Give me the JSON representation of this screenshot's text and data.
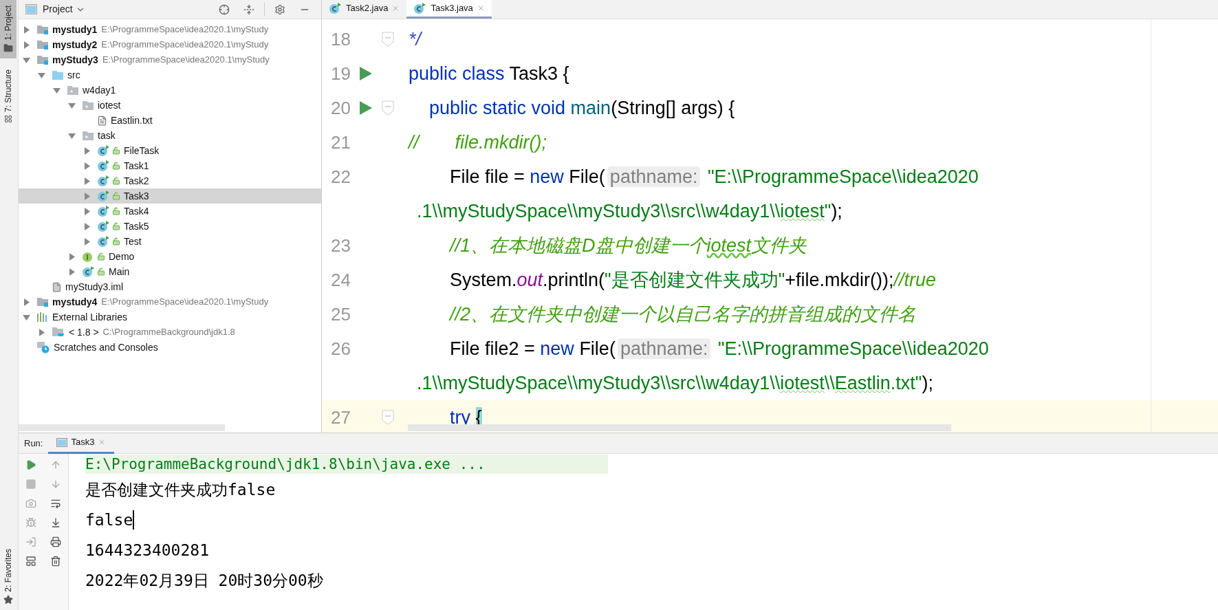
{
  "tool_strip": {
    "top": [
      {
        "label": "1: Project",
        "kind": "folder",
        "selected": true
      },
      {
        "label": "7: Structure",
        "kind": "structure",
        "selected": false
      }
    ],
    "bottom": [
      {
        "label": "2: Favorites",
        "kind": "star",
        "selected": false
      }
    ]
  },
  "project_panel": {
    "title": "Project"
  },
  "tree": [
    {
      "label": "mystudy1",
      "path": "E:\\ProgrammeSpace\\idea2020.1\\myStudy",
      "kind": "module",
      "expanded": false,
      "selected": false
    },
    {
      "label": "mystudy2",
      "path": "E:\\ProgrammeSpace\\idea2020.1\\myStudy",
      "kind": "module",
      "expanded": false,
      "selected": false
    },
    {
      "label": "myStudy3",
      "path": "E:\\ProgrammeSpace\\idea2020.1\\myStudy",
      "kind": "module",
      "expanded": true,
      "selected": false,
      "children": [
        {
          "label": "src",
          "kind": "source",
          "expanded": true,
          "selected": false,
          "children": [
            {
              "label": "w4day1",
              "kind": "package",
              "expanded": true,
              "selected": false,
              "children": [
                {
                  "label": "iotest",
                  "kind": "package",
                  "expanded": true,
                  "selected": false,
                  "children": [
                    {
                      "label": "Eastlin.txt",
                      "kind": "text-file",
                      "selected": false
                    }
                  ]
                },
                {
                  "label": "task",
                  "kind": "package",
                  "expanded": true,
                  "selected": false,
                  "children": [
                    {
                      "label": "FileTask",
                      "kind": "class",
                      "expanded": false,
                      "selected": false
                    },
                    {
                      "label": "Task1",
                      "kind": "class",
                      "expanded": false,
                      "selected": false
                    },
                    {
                      "label": "Task2",
                      "kind": "class",
                      "expanded": false,
                      "selected": false
                    },
                    {
                      "label": "Task3",
                      "kind": "class",
                      "expanded": false,
                      "selected": true
                    },
                    {
                      "label": "Task4",
                      "kind": "class",
                      "expanded": false,
                      "selected": false
                    },
                    {
                      "label": "Task5",
                      "kind": "class",
                      "expanded": false,
                      "selected": false
                    },
                    {
                      "label": "Test",
                      "kind": "class",
                      "expanded": false,
                      "selected": false
                    }
                  ]
                },
                {
                  "label": "Demo",
                  "kind": "interface",
                  "expanded": false,
                  "selected": false
                },
                {
                  "label": "Main",
                  "kind": "class",
                  "expanded": false,
                  "selected": false
                }
              ]
            }
          ]
        },
        {
          "label": "myStudy3.iml",
          "kind": "module-file",
          "selected": false
        }
      ]
    },
    {
      "label": "mystudy4",
      "path": "E:\\ProgrammeSpace\\idea2020.1\\myStudy",
      "kind": "module",
      "expanded": false,
      "selected": false
    },
    {
      "label": "External Libraries",
      "kind": "libraries",
      "expanded": true,
      "selected": false,
      "children": [
        {
          "label": "< 1.8 >",
          "path": "C:\\ProgrammeBackground\\jdk1.8",
          "kind": "sdk",
          "expanded": false,
          "selected": false
        }
      ]
    },
    {
      "label": "Scratches and Consoles",
      "kind": "scratches",
      "selected": false
    }
  ],
  "editor_tabs": [
    {
      "label": "Task2.java",
      "selected": false
    },
    {
      "label": "Task3.java",
      "selected": true
    }
  ],
  "code_lines": [
    {
      "number": "18",
      "fold": true,
      "tokens": [
        {
          "kind": "doc",
          "text": "*/"
        }
      ]
    },
    {
      "number": "19",
      "run": true,
      "tokens": [
        {
          "kind": "keyword",
          "text": "public class "
        },
        {
          "kind": "plain",
          "text": "Task3 {"
        }
      ]
    },
    {
      "number": "20",
      "fold": true,
      "run": true,
      "tokens": [
        {
          "kind": "keyword",
          "text": "    public static void "
        },
        {
          "kind": "method",
          "text": "main"
        },
        {
          "kind": "plain",
          "text": "(String[] args) {"
        }
      ]
    },
    {
      "number": "21",
      "tokens": [
        {
          "kind": "comment",
          "text": "//       file.mkdir();"
        }
      ]
    },
    {
      "number": "22",
      "tokens": [
        {
          "kind": "plain",
          "text": "        File file = "
        },
        {
          "kind": "keyword",
          "text": "new "
        },
        {
          "kind": "plain",
          "text": "File("
        },
        {
          "kind": "hint",
          "text": "pathname:"
        },
        {
          "kind": "string",
          "text": " \"E:\\\\ProgrammeSpace\\\\idea2020"
        }
      ]
    },
    {
      "tokens": [
        {
          "kind": "string",
          "text": ".1\\\\myStudySpace\\\\myStudy3\\\\src\\\\w4day1\\\\"
        },
        {
          "kind": "typo-string",
          "text": "iotest"
        },
        {
          "kind": "string",
          "text": "\""
        },
        {
          "kind": "plain",
          "text": ");"
        }
      ]
    },
    {
      "number": "23",
      "tokens": [
        {
          "kind": "comment",
          "text": "        //1、在本地磁盘D盘中创建一个"
        },
        {
          "kind": "typo-comment",
          "text": "iotest"
        },
        {
          "kind": "comment",
          "text": "文件夹"
        }
      ]
    },
    {
      "number": "24",
      "tokens": [
        {
          "kind": "plain",
          "text": "        System."
        },
        {
          "kind": "field",
          "text": "out"
        },
        {
          "kind": "plain",
          "text": ".println("
        },
        {
          "kind": "string",
          "text": "\"是否创建文件夹成功\""
        },
        {
          "kind": "plain",
          "text": "+file.mkdir());"
        },
        {
          "kind": "comment",
          "text": "//true"
        }
      ]
    },
    {
      "number": "25",
      "tokens": [
        {
          "kind": "comment",
          "text": "        //2、在文件夹中创建一个以自己名字的拼音组成的文件名"
        }
      ]
    },
    {
      "number": "26",
      "tokens": [
        {
          "kind": "plain",
          "text": "        File file2 = "
        },
        {
          "kind": "keyword",
          "text": "new "
        },
        {
          "kind": "plain",
          "text": "File("
        },
        {
          "kind": "hint",
          "text": "pathname:"
        },
        {
          "kind": "string",
          "text": " \"E:\\\\ProgrammeSpace\\\\idea2020"
        }
      ]
    },
    {
      "tokens": [
        {
          "kind": "string",
          "text": ".1\\\\myStudySpace\\\\myStudy3\\\\src\\\\w4day1\\\\"
        },
        {
          "kind": "typo-string",
          "text": "iotest"
        },
        {
          "kind": "string",
          "text": "\\\\"
        },
        {
          "kind": "typo-string",
          "text": "Eastlin"
        },
        {
          "kind": "string",
          "text": ".txt\""
        },
        {
          "kind": "plain",
          "text": ");"
        }
      ]
    },
    {
      "number": "27",
      "fold": true,
      "current": true,
      "tokens": [
        {
          "kind": "keyword",
          "text": "        try "
        },
        {
          "kind": "brace-match",
          "text": "{"
        }
      ]
    }
  ],
  "run_panel": {
    "label": "Run:",
    "tabs": [
      {
        "label": "Task3",
        "selected": true
      }
    ]
  },
  "console_lines": [
    {
      "kind": "command",
      "text": "E:\\ProgrammeBackground\\jdk1.8\\bin\\java.exe ..."
    },
    {
      "kind": "output",
      "text": "是否创建文件夹成功false"
    },
    {
      "kind": "output",
      "text": "false",
      "caret": true
    },
    {
      "kind": "output",
      "text": "1644323400281"
    },
    {
      "kind": "output",
      "text": "2022年02月39日 20时30分00秒"
    }
  ]
}
